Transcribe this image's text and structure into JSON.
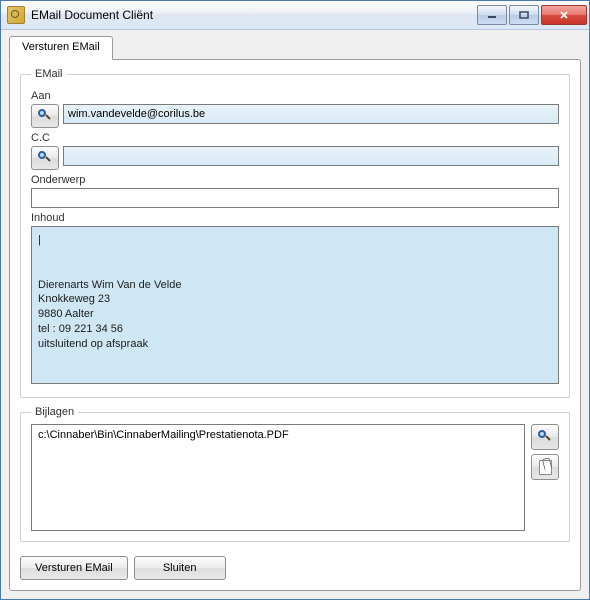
{
  "window": {
    "title": "EMail Document Cliënt"
  },
  "tab": {
    "label": "Versturen EMail"
  },
  "groups": {
    "email": "EMail",
    "attachments": "Bijlagen"
  },
  "fields": {
    "to_label": "Aan",
    "to_value": "wim.vandevelde@corilus.be",
    "cc_label": "C.C",
    "cc_value": "",
    "subject_label": "Onderwerp",
    "subject_value": "",
    "body_label": "Inhoud",
    "body_value": "|\n\n\nDierenarts Wim Van de Velde\nKnokkeweg 23\n9880 Aalter\ntel : 09 221 34 56\nuitsluitend op afspraak"
  },
  "attachments": {
    "items": [
      "c:\\Cinnaber\\Bin\\CinnaberMailing\\Prestatienota.PDF"
    ]
  },
  "buttons": {
    "send": "Versturen EMail",
    "close": "Sluiten"
  }
}
